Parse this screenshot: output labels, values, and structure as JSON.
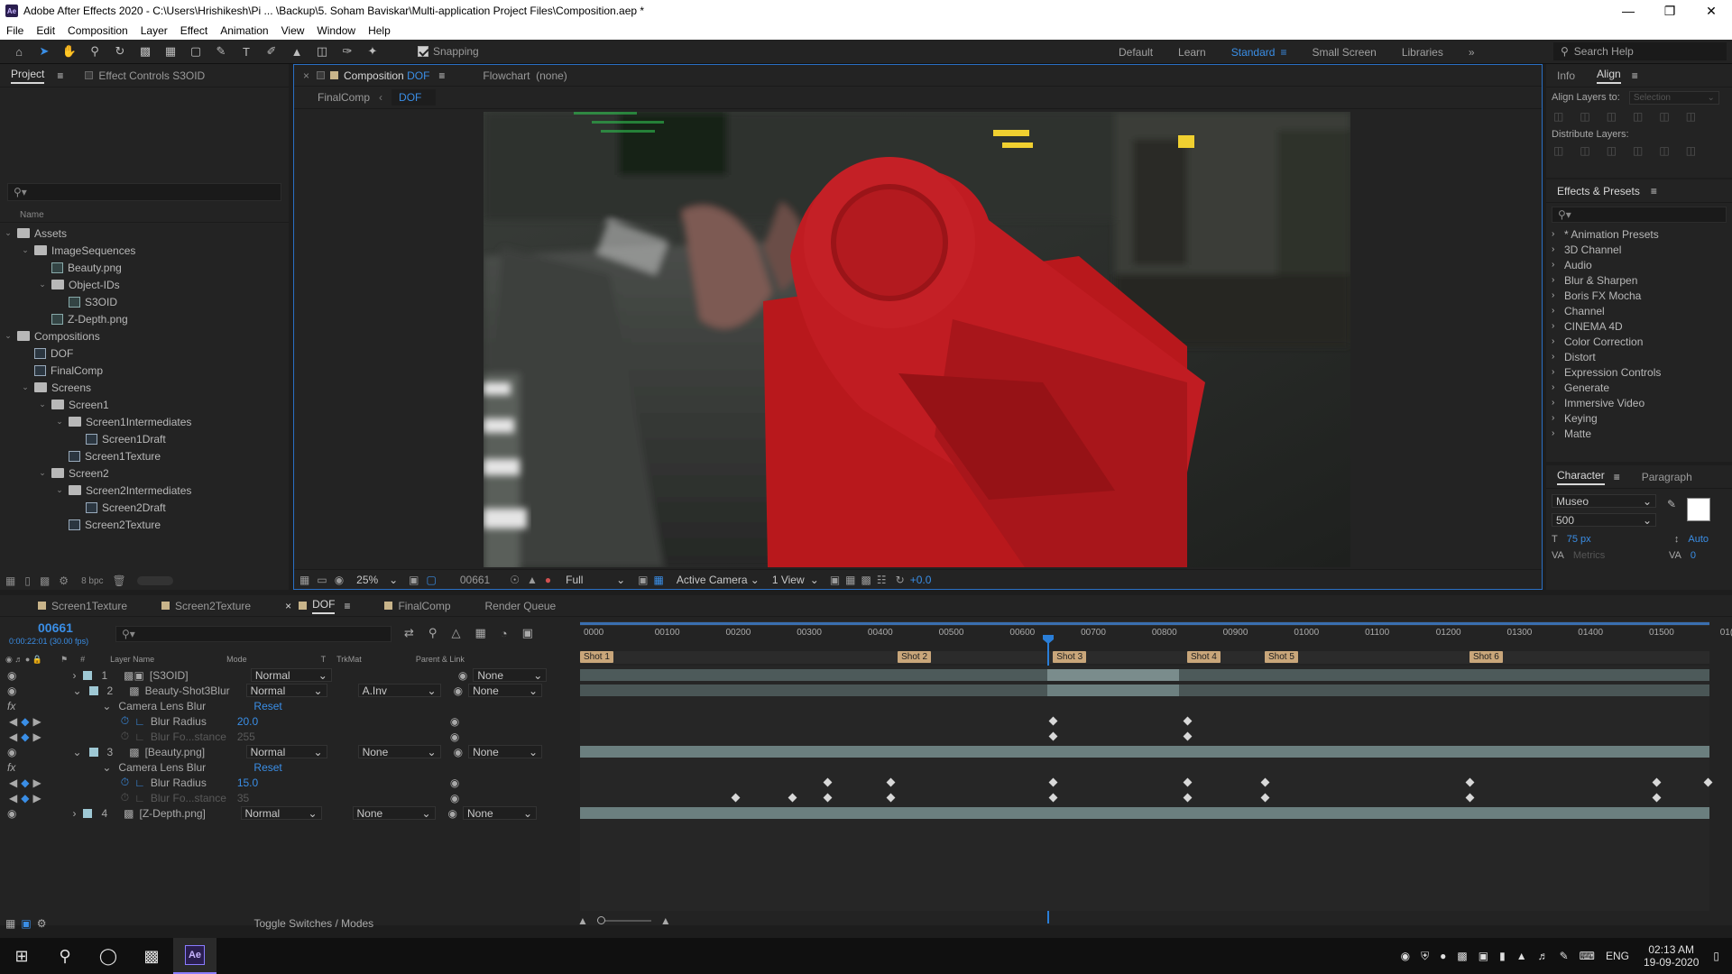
{
  "window": {
    "title": "Adobe After Effects 2020 - C:\\Users\\Hrishikesh\\Pi ... \\Backup\\5. Soham Baviskar\\Multi-application Project Files\\Composition.aep *",
    "app_badge": "Ae"
  },
  "menu": [
    "File",
    "Edit",
    "Composition",
    "Layer",
    "Effect",
    "Animation",
    "View",
    "Window",
    "Help"
  ],
  "toolbar": {
    "snapping_label": "Snapping",
    "workspaces": [
      "Default",
      "Learn",
      "Standard",
      "Small Screen",
      "Libraries"
    ],
    "active_workspace": "Standard",
    "search_placeholder": "Search Help"
  },
  "project_panel": {
    "tabs": [
      "Project",
      "Effect Controls S3OID"
    ],
    "column_header": "Name",
    "bpc": "8 bpc",
    "tree": [
      {
        "label": "Assets",
        "type": "folder",
        "depth": 0
      },
      {
        "label": "ImageSequences",
        "type": "folder",
        "depth": 1
      },
      {
        "label": "Beauty.png",
        "type": "image",
        "depth": 2
      },
      {
        "label": "Object-IDs",
        "type": "folder",
        "depth": 2
      },
      {
        "label": "S3OID",
        "type": "image",
        "depth": 3
      },
      {
        "label": "Z-Depth.png",
        "type": "image",
        "depth": 2
      },
      {
        "label": "Compositions",
        "type": "folder",
        "depth": 0
      },
      {
        "label": "DOF",
        "type": "comp",
        "depth": 1
      },
      {
        "label": "FinalComp",
        "type": "comp",
        "depth": 1
      },
      {
        "label": "Screens",
        "type": "folder",
        "depth": 1
      },
      {
        "label": "Screen1",
        "type": "folder",
        "depth": 2
      },
      {
        "label": "Screen1Intermediates",
        "type": "folder",
        "depth": 3
      },
      {
        "label": "Screen1Draft",
        "type": "comp",
        "depth": 4
      },
      {
        "label": "Screen1Texture",
        "type": "comp",
        "depth": 3
      },
      {
        "label": "Screen2",
        "type": "folder",
        "depth": 2
      },
      {
        "label": "Screen2Intermediates",
        "type": "folder",
        "depth": 3
      },
      {
        "label": "Screen2Draft",
        "type": "comp",
        "depth": 4
      },
      {
        "label": "Screen2Texture",
        "type": "comp",
        "depth": 3
      }
    ]
  },
  "viewer": {
    "tab_prefix": "Composition",
    "tab_comp": "DOF",
    "flowchart": "Flowchart",
    "flowchart_value": "(none)",
    "breadcrumbs": [
      "FinalComp",
      "DOF"
    ],
    "zoom": "25%",
    "timecode": "00661",
    "resolution": "Full",
    "camera": "Active Camera",
    "views": "1 View",
    "exposure": "+0.0"
  },
  "right_panel": {
    "top_tabs": [
      "Info",
      "Align"
    ],
    "align_to_label": "Align Layers to:",
    "align_to_value": "Selection",
    "distribute_label": "Distribute Layers:",
    "effects_title": "Effects & Presets",
    "effects": [
      "* Animation Presets",
      "3D Channel",
      "Audio",
      "Blur & Sharpen",
      "Boris FX Mocha",
      "Channel",
      "CINEMA 4D",
      "Color Correction",
      "Distort",
      "Expression Controls",
      "Generate",
      "Immersive Video",
      "Keying",
      "Matte"
    ],
    "char_tabs": [
      "Character",
      "Paragraph"
    ],
    "font": "Museo",
    "weight": "500",
    "size": "75 px",
    "leading": "Auto",
    "metrics": "Metrics",
    "tracking": "0"
  },
  "timeline": {
    "tabs": [
      "Screen1Texture",
      "Screen2Texture",
      "DOF",
      "FinalComp",
      "Render Queue"
    ],
    "active_tab": "DOF",
    "timecode": "00661",
    "timecode_sub": "0:00:22:01 (30.00 fps)",
    "col_headers": {
      "layer": "Layer Name",
      "mode": "Mode",
      "t": "T",
      "trkmat": "TrkMat",
      "parent": "Parent & Link"
    },
    "ruler": [
      "0000",
      "00100",
      "00200",
      "00300",
      "00400",
      "00500",
      "00600",
      "00700",
      "00800",
      "00900",
      "01000",
      "01100",
      "01200",
      "01300",
      "01400",
      "01500",
      "01("
    ],
    "markers": [
      "Shot 1",
      "Shot 2",
      "Shot 3",
      "Shot 4",
      "Shot 5",
      "Shot 6"
    ],
    "layers": [
      {
        "num": "1",
        "name": "[S3OID]",
        "mode": "Normal",
        "trkmat": "",
        "parent": "None"
      },
      {
        "num": "2",
        "name": "Beauty-Shot3Blur",
        "mode": "Normal",
        "trkmat": "A.Inv",
        "parent": "None"
      },
      {
        "num": "3",
        "name": "[Beauty.png]",
        "mode": "Normal",
        "trkmat": "None",
        "parent": "None"
      },
      {
        "num": "4",
        "name": "[Z-Depth.png]",
        "mode": "Normal",
        "trkmat": "None",
        "parent": "None"
      }
    ],
    "effect_name": "Camera Lens Blur",
    "reset": "Reset",
    "blur_radius_label": "Blur Radius",
    "blur_focus_label": "Blur Fo...stance",
    "l2_blur_radius": "20.0",
    "l2_blur_focus": "255",
    "l3_blur_radius": "15.0",
    "l3_blur_focus": "35",
    "toggle_label": "Toggle Switches / Modes"
  },
  "taskbar": {
    "lang": "ENG",
    "time": "02:13 AM",
    "date": "19-09-2020"
  }
}
